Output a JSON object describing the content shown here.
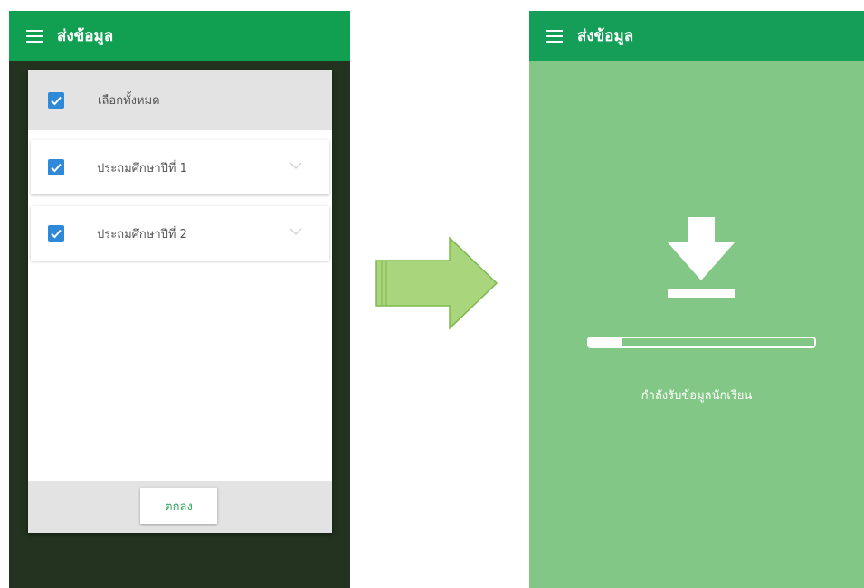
{
  "left_screen": {
    "appbar": {
      "menu_icon": "hamburger-menu-icon",
      "title": "ส่งข้อมูล"
    },
    "dialog": {
      "select_all": {
        "label": "เลือกทั้งหมด",
        "checked": true
      },
      "items": [
        {
          "label": "ประถมศึกษาปีที่ 1",
          "checked": true,
          "expand_icon": "chevron-down-icon"
        },
        {
          "label": "ประถมศึกษาปีที่ 2",
          "checked": true,
          "expand_icon": "chevron-down-icon"
        }
      ],
      "ok_label": "ตกลง"
    }
  },
  "arrow_icon": "right-arrow-icon",
  "right_screen": {
    "appbar": {
      "menu_icon": "hamburger-menu-icon",
      "title": "ส่งข้อมูล"
    },
    "download_icon": "download-icon",
    "progress": 0.15,
    "status": "กำลังรับข้อมูลนักเรียน"
  },
  "colors": {
    "appbar_green": "#11a051",
    "left_background": "#23331f",
    "right_background": "#82c785",
    "checkbox_blue": "#2e8ad8",
    "arrow_fill": "#a9d57c",
    "arrow_stroke": "#7eb84f"
  }
}
